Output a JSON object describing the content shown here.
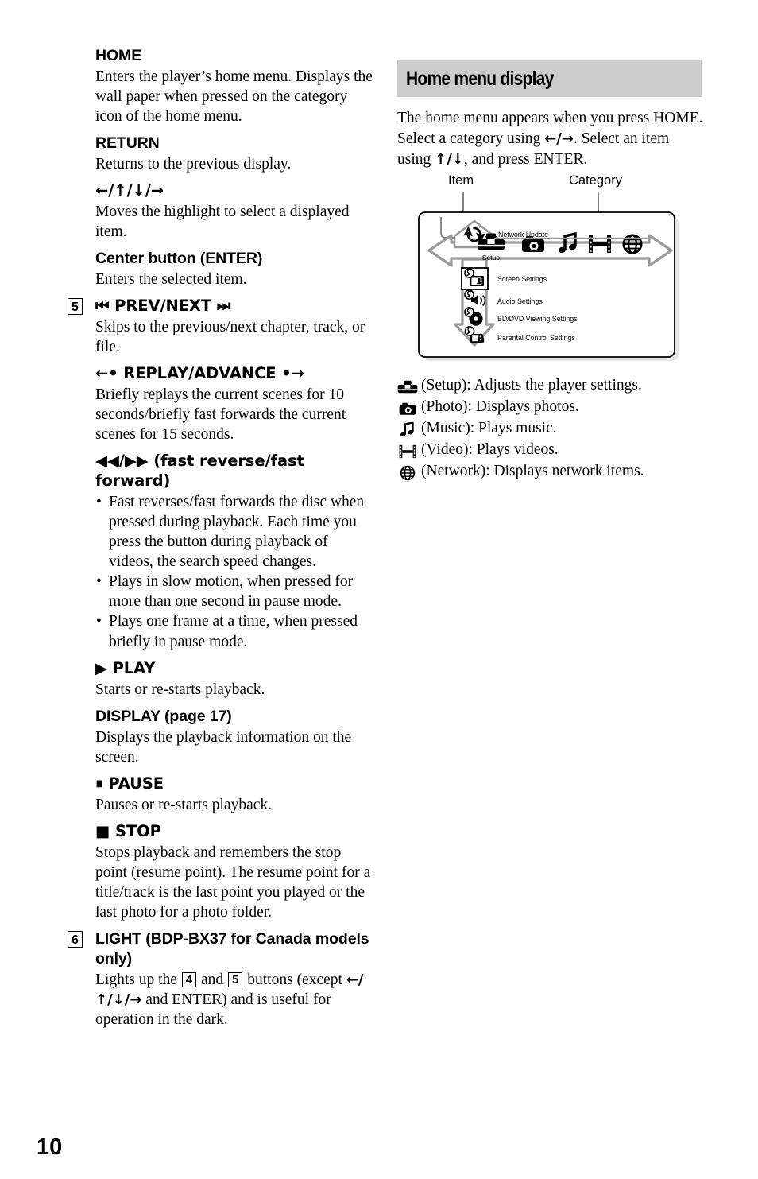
{
  "page": {
    "number": "10"
  },
  "left_column": {
    "entries": [
      {
        "marker": "",
        "heading": "HOME",
        "body": "Enters the player’s home menu. Displays the wall paper when pressed on the category icon of the home menu."
      },
      {
        "marker": "",
        "heading": "RETURN",
        "body": "Returns to the previous display."
      },
      {
        "marker": "",
        "heading": "←/↑/↓/→",
        "body": "Moves the highlight to select a displayed item."
      },
      {
        "marker": "",
        "heading": "Center button (ENTER)",
        "body": "Enters the selected item."
      },
      {
        "marker": "5",
        "heading": "⏮ PREV/NEXT ⏭",
        "body": "Skips to the previous/next chapter, track, or file."
      },
      {
        "marker": "",
        "heading": "←• REPLAY/ADVANCE •→",
        "body": "Briefly replays the current scenes for 10 seconds/briefly fast forwards the current scenes for 15 seconds."
      },
      {
        "marker": "",
        "heading": "◀◀/▶▶ (fast reverse/fast forward)",
        "bullets": [
          "Fast reverses/fast forwards the disc when pressed during playback. Each time you press the button during playback of videos, the search speed changes.",
          "Plays in slow motion, when pressed for more than one second in pause mode.",
          "Plays one frame at a time, when pressed briefly in pause mode."
        ]
      },
      {
        "marker": "",
        "heading": "▶ PLAY",
        "body": "Starts or re-starts playback."
      },
      {
        "marker": "",
        "heading": "DISPLAY (page 17)",
        "body": "Displays the playback information on the screen."
      },
      {
        "marker": "",
        "heading": "⏸ PAUSE",
        "body": "Pauses or re-starts playback."
      },
      {
        "marker": "",
        "heading": "■ STOP",
        "body": "Stops playback and remembers the stop point (resume point). The resume point for a title/track is the last point you played or the last photo for a photo folder."
      },
      {
        "marker": "6",
        "heading": "LIGHT (BDP-BX37 for Canada models only)",
        "body_parts": {
          "p1": "Lights up the ",
          "btn1": "4",
          "p2": " and ",
          "btn2": "5",
          "p3": " buttons (except ",
          "arrows": "←/↑/↓/→",
          "p4": " and ENTER) and is useful for operation in the dark."
        }
      }
    ]
  },
  "right_column": {
    "section_title": "Home menu display",
    "intro": "The home menu appears when you press HOME. Select a category using ",
    "intro_arrows_lr": "←/→",
    "intro_mid": ". Select an item using ",
    "intro_arrows_ud": "↑/↓",
    "intro_end": ", and press ENTER.",
    "diagram": {
      "callout_item": "Item",
      "callout_category": "Category",
      "network_update_label": "Network Update",
      "setup_label": "Setup",
      "categories": [
        {
          "icon": "toolbox-icon",
          "name": "Setup"
        },
        {
          "icon": "camera-icon",
          "name": "Photo"
        },
        {
          "icon": "music-note-icon",
          "name": "Music"
        },
        {
          "icon": "film-strip-icon",
          "name": "Video"
        },
        {
          "icon": "globe-icon",
          "name": "Network"
        }
      ],
      "items": [
        {
          "icon": "screen-settings-icon",
          "label": "Screen Settings",
          "selected": true
        },
        {
          "icon": "audio-settings-icon",
          "label": "Audio Settings",
          "selected": false
        },
        {
          "icon": "bd-dvd-settings-icon",
          "label": "BD/DVD Viewing Settings",
          "selected": false
        },
        {
          "icon": "parental-control-icon",
          "label": "Parental Control Settings",
          "selected": false
        }
      ]
    },
    "legend": [
      {
        "icon": "toolbox-icon",
        "text": "(Setup): Adjusts the player settings."
      },
      {
        "icon": "camera-icon",
        "text": "(Photo): Displays photos."
      },
      {
        "icon": "music-note-icon",
        "text": "(Music): Plays music."
      },
      {
        "icon": "film-strip-icon",
        "text": "(Video): Plays videos."
      },
      {
        "icon": "globe-icon",
        "text": "(Network): Displays network items."
      }
    ]
  },
  "colors": {
    "section_bar_bg": "#cccccc",
    "diagram_arrow": "#808080",
    "text": "#000000"
  }
}
